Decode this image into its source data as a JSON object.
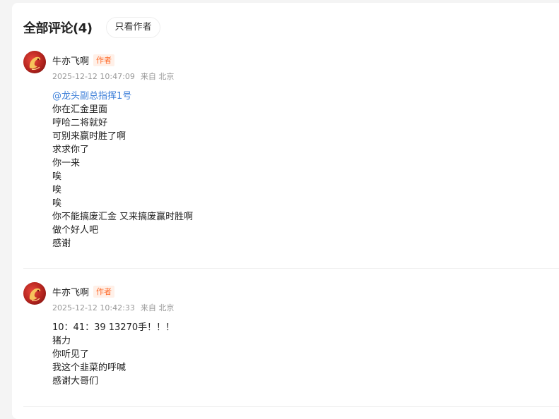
{
  "header": {
    "title": "全部评论(4)",
    "author_only": "只看作者"
  },
  "comments": [
    {
      "username": "牛亦飞啊",
      "badge": "作者",
      "time": "2025-12-12 10:47:09",
      "location": "来自 北京",
      "mention": "@龙头副总指挥1号",
      "lines": [
        "你在汇金里面",
        "哼哈二将就好",
        "可别来赢时胜了啊",
        "求求你了",
        "你一来",
        "唉",
        "唉",
        "唉",
        "你不能搞废汇金 又来搞废赢时胜啊",
        "做个好人吧",
        "感谢"
      ]
    },
    {
      "username": "牛亦飞啊",
      "badge": "作者",
      "time": "2025-12-12 10:42:33",
      "location": "来自 北京",
      "lines": [
        "10：41：39 13270手！！！",
        "猪力",
        "你听见了",
        "我这个韭菜的呼喊",
        "感谢大哥们"
      ]
    }
  ],
  "colors": {
    "mention": "#3b7ed8",
    "badge_text": "#ff6a28",
    "badge_bg": "#fff0e8",
    "meta": "#999999"
  }
}
